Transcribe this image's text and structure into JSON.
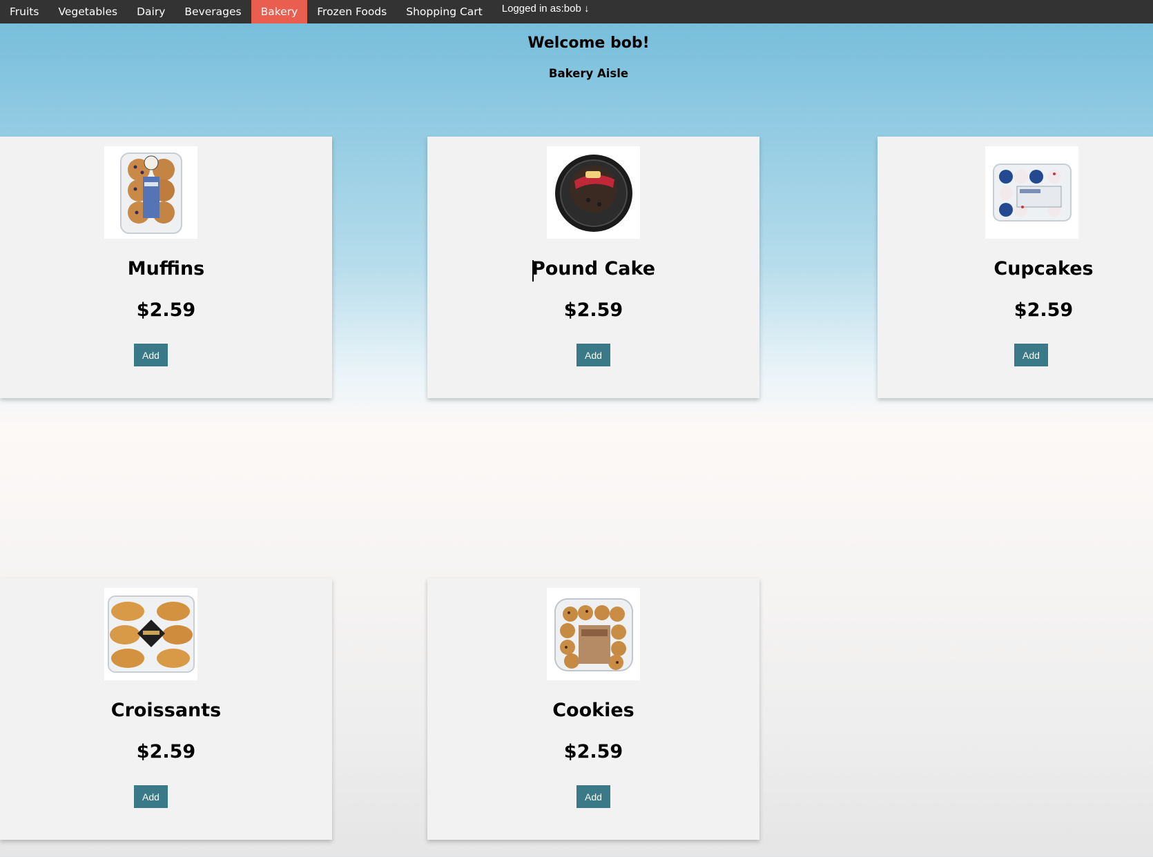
{
  "nav": {
    "items": [
      {
        "label": "Fruits"
      },
      {
        "label": "Vegetables"
      },
      {
        "label": "Dairy"
      },
      {
        "label": "Beverages"
      },
      {
        "label": "Bakery",
        "active": true
      },
      {
        "label": "Frozen Foods"
      },
      {
        "label": "Shopping Cart"
      }
    ],
    "user_label": "Logged in as:bob ↓"
  },
  "header": {
    "welcome": "Welcome bob!",
    "aisle": "Bakery Aisle"
  },
  "products": [
    {
      "name": "Muffins",
      "price": "$2.59",
      "add_label": "Add",
      "icon": "muffins-package-icon"
    },
    {
      "name": "Pound Cake",
      "price": "$2.59",
      "add_label": "Add",
      "icon": "pound-cake-package-icon"
    },
    {
      "name": "Cupcakes",
      "price": "$2.59",
      "add_label": "Add",
      "icon": "cupcakes-package-icon"
    },
    {
      "name": "Croissants",
      "price": "$2.59",
      "add_label": "Add",
      "icon": "croissants-package-icon"
    },
    {
      "name": "Cookies",
      "price": "$2.59",
      "add_label": "Add",
      "icon": "cookies-package-icon"
    }
  ],
  "colors": {
    "navbar": "#333333",
    "active_tab": "#ea5e50",
    "add_button": "#3a7a88",
    "card": "#f2f2f2"
  }
}
